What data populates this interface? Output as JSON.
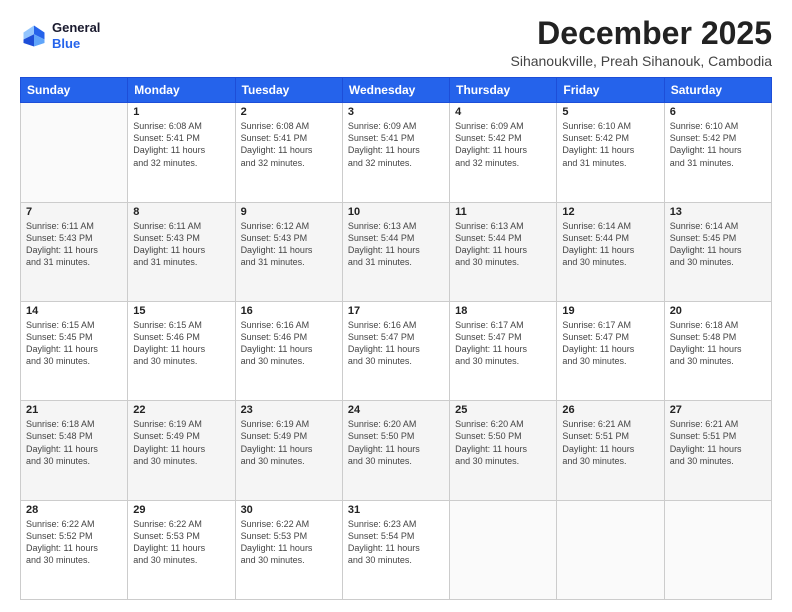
{
  "logo": {
    "line1": "General",
    "line2": "Blue"
  },
  "title": "December 2025",
  "subtitle": "Sihanoukville, Preah Sihanouk, Cambodia",
  "days_of_week": [
    "Sunday",
    "Monday",
    "Tuesday",
    "Wednesday",
    "Thursday",
    "Friday",
    "Saturday"
  ],
  "weeks": [
    [
      {
        "day": "",
        "sunrise": "",
        "sunset": "",
        "daylight": ""
      },
      {
        "day": "1",
        "sunrise": "Sunrise: 6:08 AM",
        "sunset": "Sunset: 5:41 PM",
        "daylight": "Daylight: 11 hours and 32 minutes."
      },
      {
        "day": "2",
        "sunrise": "Sunrise: 6:08 AM",
        "sunset": "Sunset: 5:41 PM",
        "daylight": "Daylight: 11 hours and 32 minutes."
      },
      {
        "day": "3",
        "sunrise": "Sunrise: 6:09 AM",
        "sunset": "Sunset: 5:41 PM",
        "daylight": "Daylight: 11 hours and 32 minutes."
      },
      {
        "day": "4",
        "sunrise": "Sunrise: 6:09 AM",
        "sunset": "Sunset: 5:42 PM",
        "daylight": "Daylight: 11 hours and 32 minutes."
      },
      {
        "day": "5",
        "sunrise": "Sunrise: 6:10 AM",
        "sunset": "Sunset: 5:42 PM",
        "daylight": "Daylight: 11 hours and 31 minutes."
      },
      {
        "day": "6",
        "sunrise": "Sunrise: 6:10 AM",
        "sunset": "Sunset: 5:42 PM",
        "daylight": "Daylight: 11 hours and 31 minutes."
      }
    ],
    [
      {
        "day": "7",
        "sunrise": "Sunrise: 6:11 AM",
        "sunset": "Sunset: 5:43 PM",
        "daylight": "Daylight: 11 hours and 31 minutes."
      },
      {
        "day": "8",
        "sunrise": "Sunrise: 6:11 AM",
        "sunset": "Sunset: 5:43 PM",
        "daylight": "Daylight: 11 hours and 31 minutes."
      },
      {
        "day": "9",
        "sunrise": "Sunrise: 6:12 AM",
        "sunset": "Sunset: 5:43 PM",
        "daylight": "Daylight: 11 hours and 31 minutes."
      },
      {
        "day": "10",
        "sunrise": "Sunrise: 6:13 AM",
        "sunset": "Sunset: 5:44 PM",
        "daylight": "Daylight: 11 hours and 31 minutes."
      },
      {
        "day": "11",
        "sunrise": "Sunrise: 6:13 AM",
        "sunset": "Sunset: 5:44 PM",
        "daylight": "Daylight: 11 hours and 30 minutes."
      },
      {
        "day": "12",
        "sunrise": "Sunrise: 6:14 AM",
        "sunset": "Sunset: 5:44 PM",
        "daylight": "Daylight: 11 hours and 30 minutes."
      },
      {
        "day": "13",
        "sunrise": "Sunrise: 6:14 AM",
        "sunset": "Sunset: 5:45 PM",
        "daylight": "Daylight: 11 hours and 30 minutes."
      }
    ],
    [
      {
        "day": "14",
        "sunrise": "Sunrise: 6:15 AM",
        "sunset": "Sunset: 5:45 PM",
        "daylight": "Daylight: 11 hours and 30 minutes."
      },
      {
        "day": "15",
        "sunrise": "Sunrise: 6:15 AM",
        "sunset": "Sunset: 5:46 PM",
        "daylight": "Daylight: 11 hours and 30 minutes."
      },
      {
        "day": "16",
        "sunrise": "Sunrise: 6:16 AM",
        "sunset": "Sunset: 5:46 PM",
        "daylight": "Daylight: 11 hours and 30 minutes."
      },
      {
        "day": "17",
        "sunrise": "Sunrise: 6:16 AM",
        "sunset": "Sunset: 5:47 PM",
        "daylight": "Daylight: 11 hours and 30 minutes."
      },
      {
        "day": "18",
        "sunrise": "Sunrise: 6:17 AM",
        "sunset": "Sunset: 5:47 PM",
        "daylight": "Daylight: 11 hours and 30 minutes."
      },
      {
        "day": "19",
        "sunrise": "Sunrise: 6:17 AM",
        "sunset": "Sunset: 5:47 PM",
        "daylight": "Daylight: 11 hours and 30 minutes."
      },
      {
        "day": "20",
        "sunrise": "Sunrise: 6:18 AM",
        "sunset": "Sunset: 5:48 PM",
        "daylight": "Daylight: 11 hours and 30 minutes."
      }
    ],
    [
      {
        "day": "21",
        "sunrise": "Sunrise: 6:18 AM",
        "sunset": "Sunset: 5:48 PM",
        "daylight": "Daylight: 11 hours and 30 minutes."
      },
      {
        "day": "22",
        "sunrise": "Sunrise: 6:19 AM",
        "sunset": "Sunset: 5:49 PM",
        "daylight": "Daylight: 11 hours and 30 minutes."
      },
      {
        "day": "23",
        "sunrise": "Sunrise: 6:19 AM",
        "sunset": "Sunset: 5:49 PM",
        "daylight": "Daylight: 11 hours and 30 minutes."
      },
      {
        "day": "24",
        "sunrise": "Sunrise: 6:20 AM",
        "sunset": "Sunset: 5:50 PM",
        "daylight": "Daylight: 11 hours and 30 minutes."
      },
      {
        "day": "25",
        "sunrise": "Sunrise: 6:20 AM",
        "sunset": "Sunset: 5:50 PM",
        "daylight": "Daylight: 11 hours and 30 minutes."
      },
      {
        "day": "26",
        "sunrise": "Sunrise: 6:21 AM",
        "sunset": "Sunset: 5:51 PM",
        "daylight": "Daylight: 11 hours and 30 minutes."
      },
      {
        "day": "27",
        "sunrise": "Sunrise: 6:21 AM",
        "sunset": "Sunset: 5:51 PM",
        "daylight": "Daylight: 11 hours and 30 minutes."
      }
    ],
    [
      {
        "day": "28",
        "sunrise": "Sunrise: 6:22 AM",
        "sunset": "Sunset: 5:52 PM",
        "daylight": "Daylight: 11 hours and 30 minutes."
      },
      {
        "day": "29",
        "sunrise": "Sunrise: 6:22 AM",
        "sunset": "Sunset: 5:53 PM",
        "daylight": "Daylight: 11 hours and 30 minutes."
      },
      {
        "day": "30",
        "sunrise": "Sunrise: 6:22 AM",
        "sunset": "Sunset: 5:53 PM",
        "daylight": "Daylight: 11 hours and 30 minutes."
      },
      {
        "day": "31",
        "sunrise": "Sunrise: 6:23 AM",
        "sunset": "Sunset: 5:54 PM",
        "daylight": "Daylight: 11 hours and 30 minutes."
      },
      {
        "day": "",
        "sunrise": "",
        "sunset": "",
        "daylight": ""
      },
      {
        "day": "",
        "sunrise": "",
        "sunset": "",
        "daylight": ""
      },
      {
        "day": "",
        "sunrise": "",
        "sunset": "",
        "daylight": ""
      }
    ]
  ]
}
